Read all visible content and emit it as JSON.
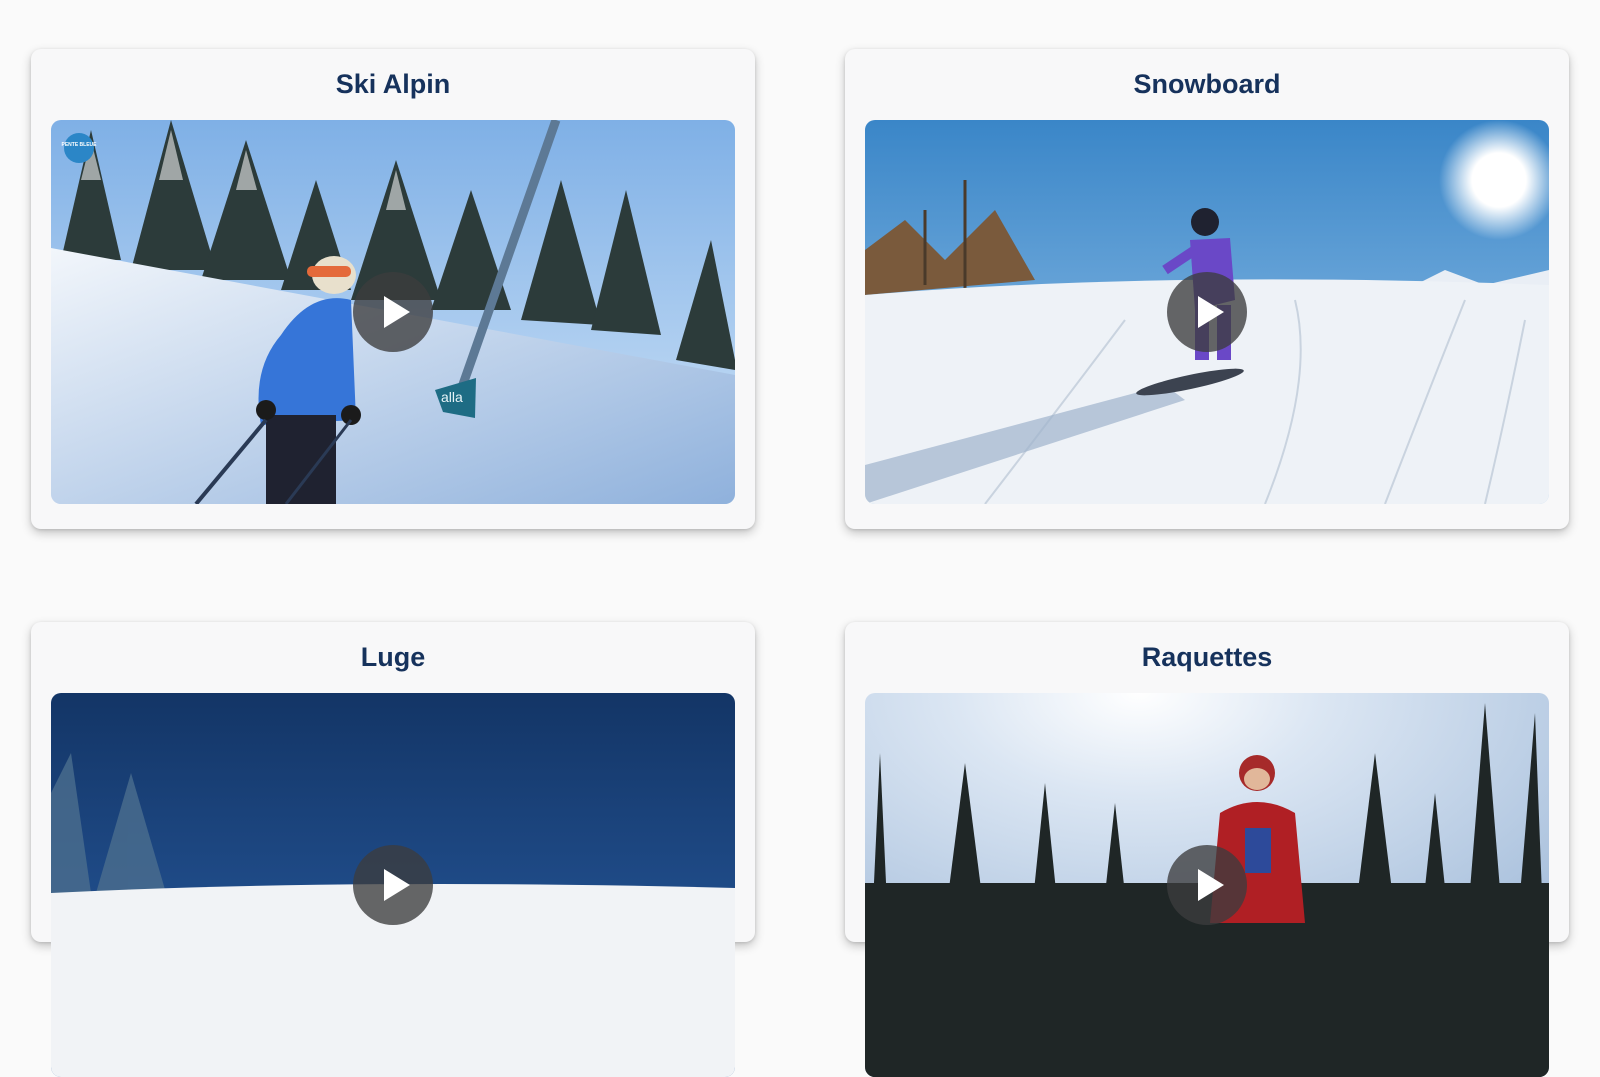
{
  "cards": [
    {
      "title": "Ski Alpin",
      "badge": "PENTE BLEUE",
      "pole_text": "alla"
    },
    {
      "title": "Snowboard"
    },
    {
      "title": "Luge"
    },
    {
      "title": "Raquettes"
    }
  ]
}
